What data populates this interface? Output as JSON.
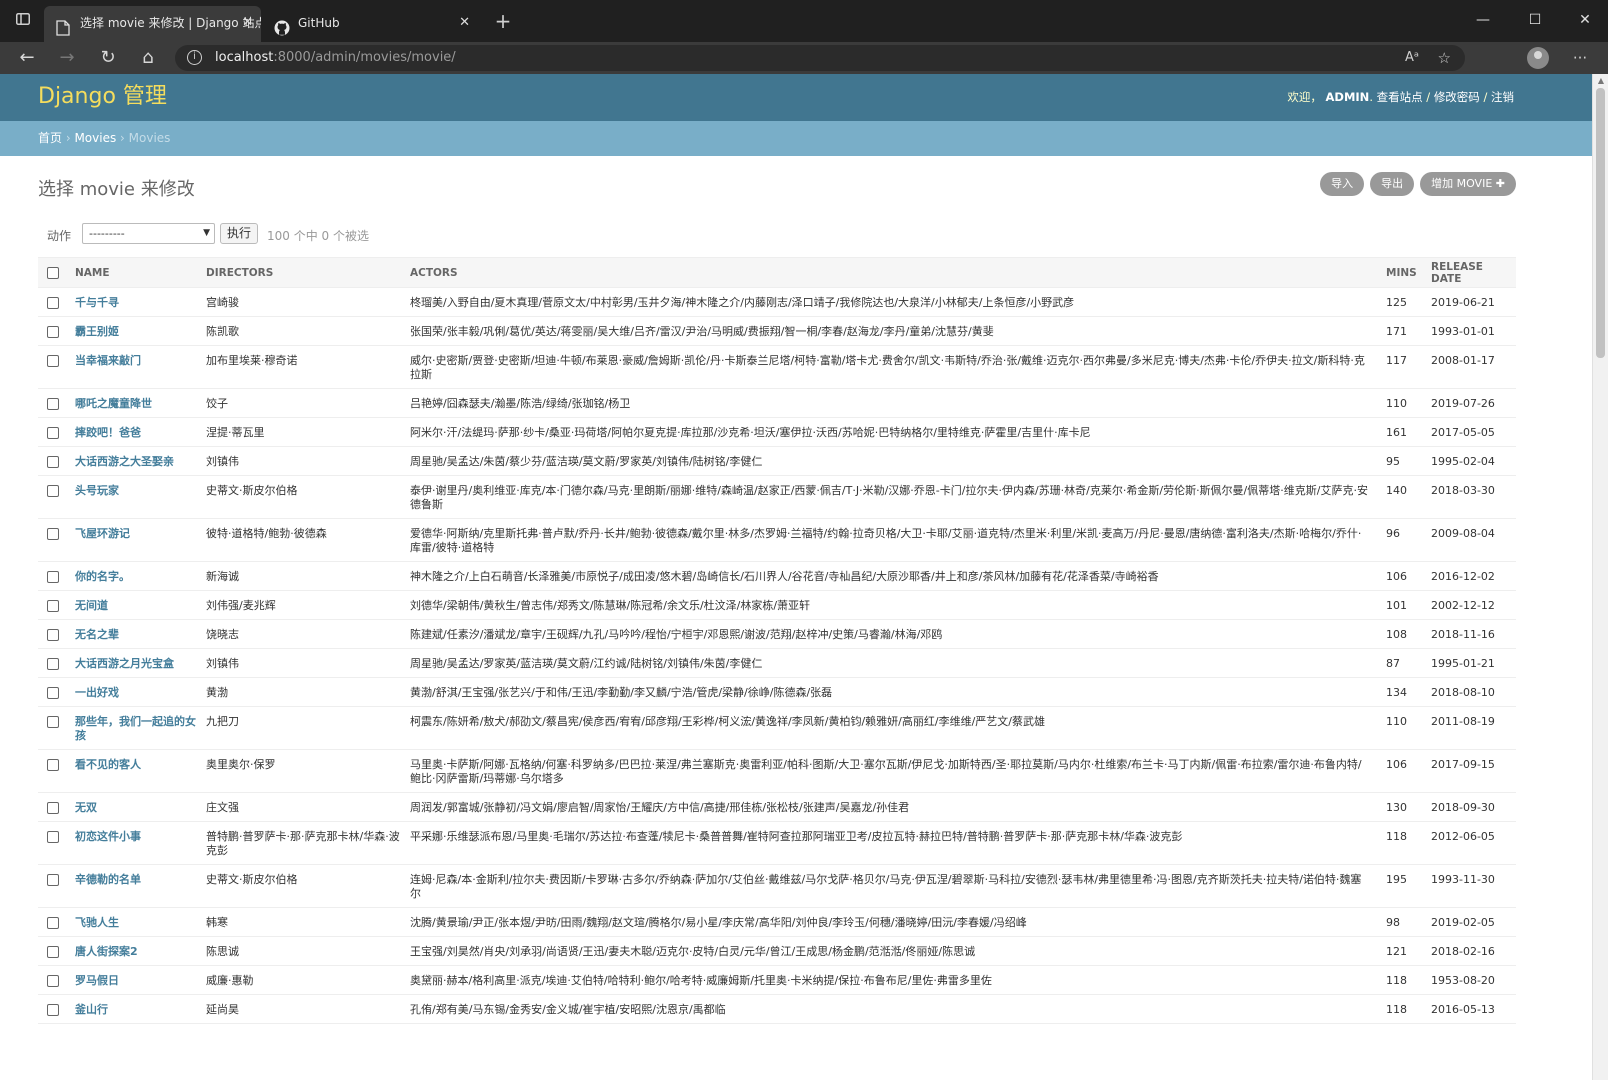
{
  "browser": {
    "tabs": [
      {
        "title": "选择 movie 来修改 | Django 站点",
        "close": "✕"
      },
      {
        "title": "GitHub",
        "close": "✕"
      }
    ],
    "new_tab": "+",
    "url_host": "localhost",
    "url_rest": ":8000/admin/movies/movie/"
  },
  "header": {
    "brand": "Django 管理",
    "welcome": "欢迎，",
    "user": "ADMIN",
    "view_site": "查看站点",
    "change_password": "修改密码",
    "logout": "注销",
    "sep": " / "
  },
  "breadcrumbs": {
    "home": "首页",
    "app": "Movies",
    "model": "Movies",
    "sep": " › "
  },
  "page": {
    "title": "选择 movie 来修改"
  },
  "object_tools": {
    "import": "导入",
    "export": "导出",
    "add": "增加 MOVIE ✚"
  },
  "actions": {
    "label": "动作",
    "selected": "---------",
    "go": "执行",
    "counter": "100 个中 0 个被选"
  },
  "table": {
    "headers": {
      "name": "NAME",
      "directors": "DIRECTORS",
      "actors": "ACTORS",
      "mins": "MINS",
      "release": "RELEASE DATE"
    },
    "rows": [
      {
        "name": "千与千寻",
        "directors": "宫崎骏",
        "actors": "柊瑠美/入野自由/夏木真理/菅原文太/中村彰男/玉井夕海/神木隆之介/内藤刚志/泽口靖子/我修院达也/大泉洋/小林郁夫/上条恒彦/小野武彦",
        "mins": "125",
        "release": "2019-06-21"
      },
      {
        "name": "霸王别姬",
        "directors": "陈凯歌",
        "actors": "张国荣/张丰毅/巩俐/葛优/英达/蒋雯丽/吴大维/吕齐/雷汉/尹治/马明威/费振翔/智一桐/李春/赵海龙/李丹/童弟/沈慧芬/黄斐",
        "mins": "171",
        "release": "1993-01-01"
      },
      {
        "name": "当幸福来敲门",
        "directors": "加布里埃莱·穆奇诺",
        "actors": "威尔·史密斯/贾登·史密斯/坦迪·牛顿/布莱恩·豪威/詹姆斯·凯伦/丹·卡斯泰兰尼塔/柯特·富勒/塔卡尤·费舍尔/凯文·韦斯特/乔治·张/戴维·迈克尔·西尔弗曼/多米尼克·博夫/杰弗·卡伦/乔伊夫·拉文/斯科特·克拉斯",
        "mins": "117",
        "release": "2008-01-17"
      },
      {
        "name": "哪吒之魔童降世",
        "directors": "饺子",
        "actors": "吕艳婷/囧森瑟夫/瀚墨/陈浩/绿绮/张珈铭/杨卫",
        "mins": "110",
        "release": "2019-07-26"
      },
      {
        "name": "摔跤吧！爸爸",
        "directors": "涅提·蒂瓦里",
        "actors": "阿米尔·汗/法缇玛·萨那·纱卡/桑亚·玛荷塔/阿帕尔夏克提·库拉那/沙克希·坦沃/塞伊拉·沃西/苏哈妮·巴特纳格尔/里特维克·萨霍里/吉里什·库卡尼",
        "mins": "161",
        "release": "2017-05-05"
      },
      {
        "name": "大话西游之大圣娶亲",
        "directors": "刘镇伟",
        "actors": "周星驰/吴孟达/朱茵/蔡少芬/蓝洁瑛/莫文蔚/罗家英/刘镇伟/陆树铭/李健仁",
        "mins": "95",
        "release": "1995-02-04"
      },
      {
        "name": "头号玩家",
        "directors": "史蒂文·斯皮尔伯格",
        "actors": "泰伊·谢里丹/奥利维亚·库克/本·门德尔森/马克·里朗斯/丽娜·维特/森崎温/赵家正/西蒙·佩吉/T·J·米勒/汉娜·乔恩-卡门/拉尔夫·伊内森/苏珊·林奇/克莱尔·希金斯/劳伦斯·斯佩尔曼/佩蒂塔·维克斯/艾萨克·安德鲁斯",
        "mins": "140",
        "release": "2018-03-30"
      },
      {
        "name": "飞屋环游记",
        "directors": "彼特·道格特/鲍勃·彼德森",
        "actors": "爱德华·阿斯纳/克里斯托弗·普卢默/乔丹·长井/鲍勃·彼德森/戴尔里·林多/杰罗姆·兰福特/约翰·拉奇贝格/大卫·卡耶/艾丽·道克特/杰里米·利里/米凯·麦高万/丹尼·曼恩/唐纳德·富利洛夫/杰斯·哈梅尔/乔什·库雷/彼特·道格特",
        "mins": "96",
        "release": "2009-08-04"
      },
      {
        "name": "你的名字。",
        "directors": "新海诚",
        "actors": "神木隆之介/上白石萌音/长泽雅美/市原悦子/成田凌/悠木碧/岛崎信长/石川界人/谷花音/寺杣昌纪/大原沙耶香/井上和彦/茶风林/加藤有花/花泽香菜/寺崎裕香",
        "mins": "106",
        "release": "2016-12-02"
      },
      {
        "name": "无间道",
        "directors": "刘伟强/麦兆辉",
        "actors": "刘德华/梁朝伟/黄秋生/曾志伟/郑秀文/陈慧琳/陈冠希/余文乐/杜汶泽/林家栋/萧亚轩",
        "mins": "101",
        "release": "2002-12-12"
      },
      {
        "name": "无名之辈",
        "directors": "饶晓志",
        "actors": "陈建斌/任素汐/潘斌龙/章宇/王砚辉/九孔/马吟吟/程怡/宁桓宇/邓恩熙/谢波/范翔/赵梓冲/史策/马睿瀚/林海/邓鸥",
        "mins": "108",
        "release": "2018-11-16"
      },
      {
        "name": "大话西游之月光宝盒",
        "directors": "刘镇伟",
        "actors": "周星驰/吴孟达/罗家英/蓝洁瑛/莫文蔚/江约诚/陆树铭/刘镇伟/朱茵/李健仁",
        "mins": "87",
        "release": "1995-01-21"
      },
      {
        "name": "一出好戏",
        "directors": "黄渤",
        "actors": "黄渤/舒淇/王宝强/张艺兴/于和伟/王迅/李勤勤/李又麟/宁浩/管虎/梁静/徐峥/陈德森/张磊",
        "mins": "134",
        "release": "2018-08-10"
      },
      {
        "name": "那些年，我们一起追的女孩",
        "directors": "九把刀",
        "actors": "柯震东/陈妍希/敖犬/郝劭文/蔡昌宪/侯彦西/宥宥/邱彦翔/王彩桦/柯义浤/黄逸祥/李凤新/黄柏钧/赖雅妍/高丽红/李维维/严艺文/蔡武雄",
        "mins": "110",
        "release": "2011-08-19"
      },
      {
        "name": "看不见的客人",
        "directors": "奥里奥尔·保罗",
        "actors": "马里奥·卡萨斯/阿娜·瓦格纳/何塞·科罗纳多/巴巴拉·莱涅/弗兰塞斯克·奥雷利亚/帕科·图斯/大卫·塞尔瓦斯/伊尼戈·加斯特西/圣·耶拉莫斯/马内尔·杜维索/布兰卡·马丁内斯/佩雷·布拉索/雷尔迪·布鲁内特/鲍比·冈萨雷斯/玛蒂娜·乌尔塔多",
        "mins": "106",
        "release": "2017-09-15"
      },
      {
        "name": "无双",
        "directors": "庄文强",
        "actors": "周润发/郭富城/张静初/冯文娟/廖启智/周家怡/王耀庆/方中信/高捷/邢佳栋/张松枝/张建声/吴嘉龙/孙佳君",
        "mins": "130",
        "release": "2018-09-30"
      },
      {
        "name": "初恋这件小事",
        "directors": "普特鹏·普罗萨卡·那·萨克那卡林/华森·波克彭",
        "actors": "平采娜·乐维瑟派布恩/马里奥·毛瑞尔/苏达拉·布查蓬/犊尼卡·桑普普舞/崔特阿查拉那阿瑞亚卫考/皮拉瓦特·赫拉巴特/普特鹏·普罗萨卡·那·萨克那卡林/华森·波克彭",
        "mins": "118",
        "release": "2012-06-05"
      },
      {
        "name": "辛德勒的名单",
        "directors": "史蒂文·斯皮尔伯格",
        "actors": "连姆·尼森/本·金斯利/拉尔夫·费因斯/卡罗琳·古多尔/乔纳森·萨加尔/艾伯丝·戴维兹/马尔戈萨·格贝尔/马克·伊瓦涅/碧翠斯·马科拉/安德烈·瑟韦林/弗里德里希·冯·图恩/克齐斯茨托夫·拉夫特/诺伯特·魏塞尔",
        "mins": "195",
        "release": "1993-11-30"
      },
      {
        "name": "飞驰人生",
        "directors": "韩寒",
        "actors": "沈腾/黄景瑜/尹正/张本煜/尹昉/田雨/魏翔/赵文瑄/腾格尔/易小星/李庆常/高华阳/刘仲良/李玲玉/何穗/潘晓婷/田沅/李春媛/冯绍峰",
        "mins": "98",
        "release": "2019-02-05"
      },
      {
        "name": "唐人街探案2",
        "directors": "陈思诚",
        "actors": "王宝强/刘昊然/肖央/刘承羽/尚语贤/王迅/妻夫木聪/迈克尔·皮特/白灵/元华/曾江/王成思/杨金鹏/范湉湉/佟丽娅/陈思诚",
        "mins": "121",
        "release": "2018-02-16"
      },
      {
        "name": "罗马假日",
        "directors": "威廉·惠勒",
        "actors": "奥黛丽·赫本/格利高里·派克/埃迪·艾伯特/哈特利·鲍尔/哈考特·威廉姆斯/托里奥·卡米纳提/保拉·布鲁布尼/里佐·弗雷多里佐",
        "mins": "118",
        "release": "1953-08-20"
      },
      {
        "name": "釜山行",
        "directors": "延尚昊",
        "actors": "孔侑/郑有美/马东锡/金秀安/金义城/崔宇植/安昭熙/沈恩京/禹都临",
        "mins": "118",
        "release": "2016-05-13"
      }
    ]
  }
}
